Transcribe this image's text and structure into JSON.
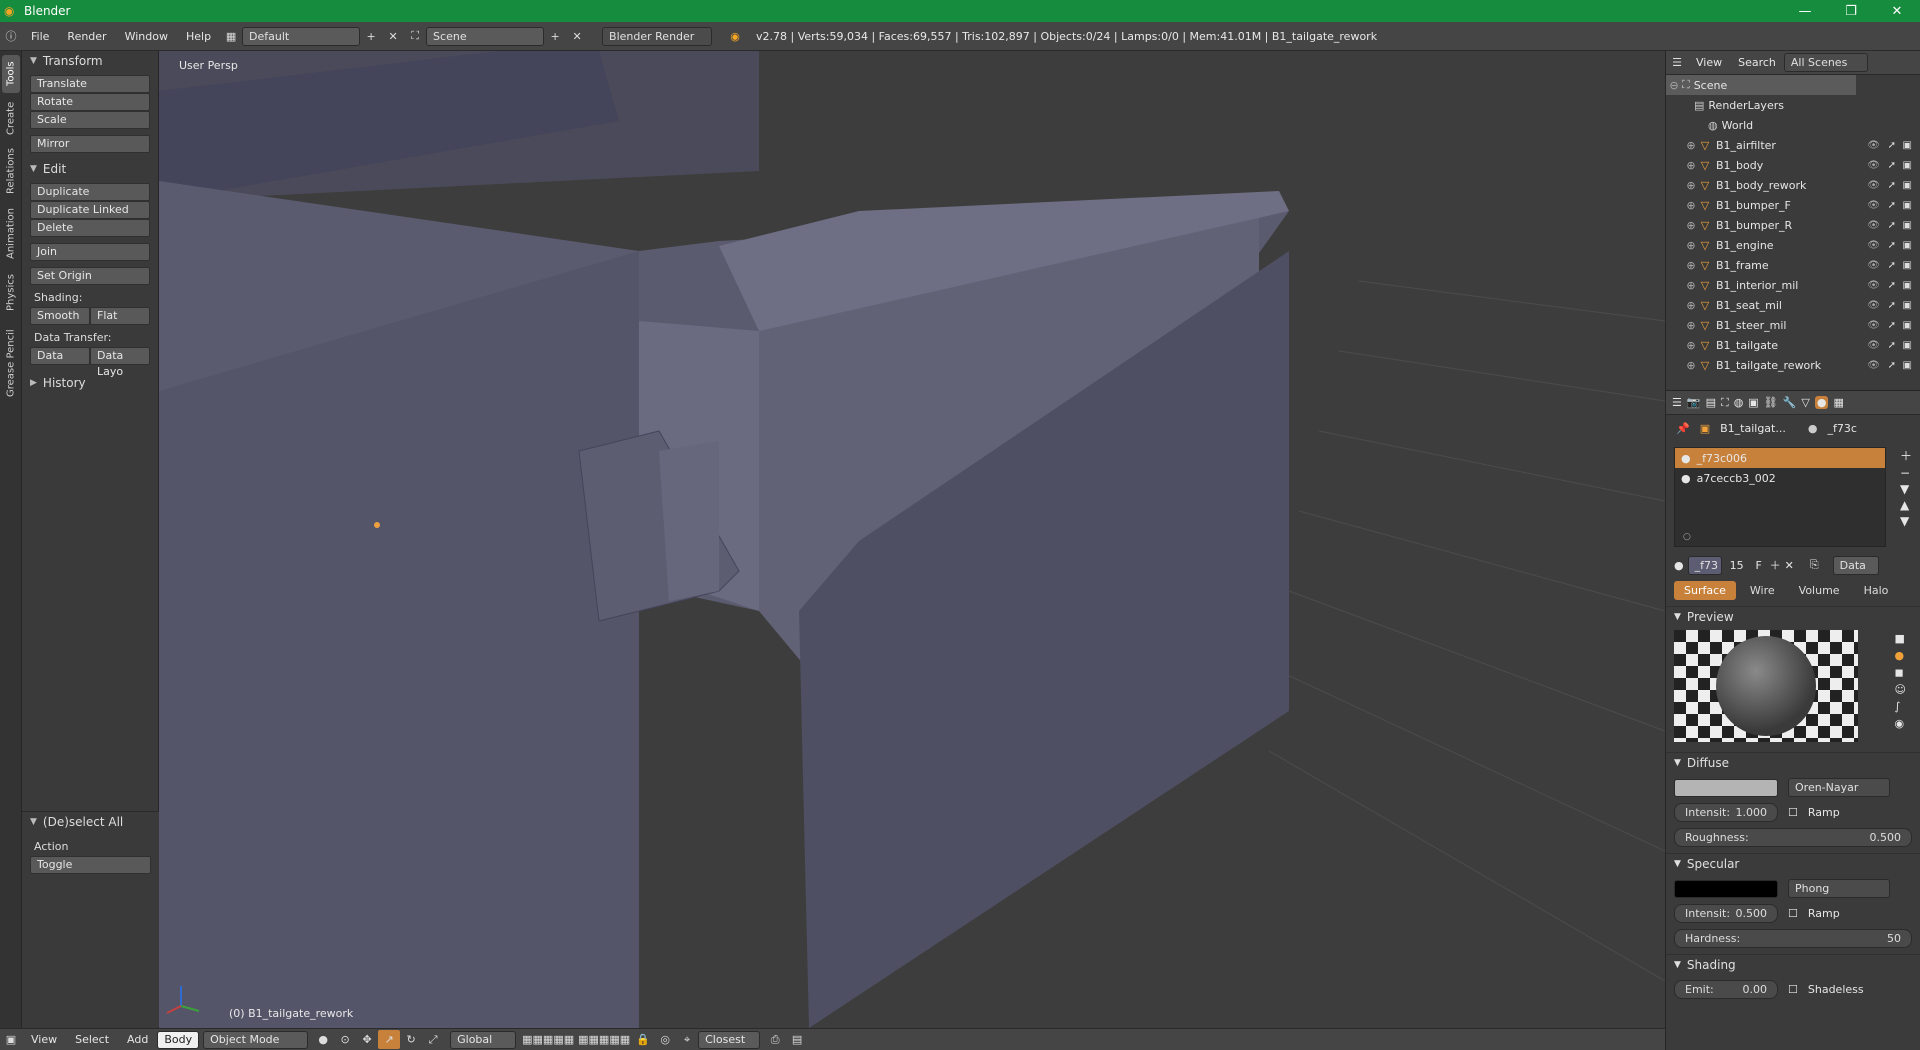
{
  "window": {
    "title": "Blender",
    "app_icon": "blender-logo-icon",
    "controls": [
      "minimize-icon",
      "maximize-icon",
      "close-icon"
    ]
  },
  "info_bar": {
    "menus": [
      "File",
      "Render",
      "Window",
      "Help"
    ],
    "layout": "Default",
    "scene": "Scene",
    "engine": "Blender Render",
    "stats": "v2.78 | Verts:59,034 | Faces:69,557 | Tris:102,897 | Objects:0/24 | Lamps:0/0 | Mem:41.01M | B1_tailgate_rework"
  },
  "left_tabs": [
    "Tools",
    "Create",
    "Relations",
    "Animation",
    "Physics",
    "Grease Pencil"
  ],
  "tool_shelf": {
    "transform": {
      "title": "Transform",
      "items": [
        "Translate",
        "Rotate",
        "Scale"
      ],
      "mirror": "Mirror"
    },
    "edit": {
      "title": "Edit",
      "items": [
        "Duplicate",
        "Duplicate Linked",
        "Delete"
      ],
      "join": "Join",
      "set_origin": "Set Origin",
      "shading_label": "Shading:",
      "smooth": "Smooth",
      "flat": "Flat",
      "data_transfer_label": "Data Transfer:",
      "data": "Data",
      "data_layo": "Data Layo"
    },
    "history": {
      "title": "History"
    },
    "operator": {
      "title": "(De)select All",
      "action_label": "Action",
      "action_value": "Toggle"
    }
  },
  "viewport": {
    "label": "User Persp",
    "object": "(0) B1_tailgate_rework"
  },
  "bottom_bar": {
    "menus": [
      "View",
      "Select",
      "Add"
    ],
    "body": "Body",
    "mode": "Object Mode",
    "orientation": "Global",
    "snap": "Closest"
  },
  "outliner": {
    "header": {
      "view": "View",
      "search": "Search",
      "scope": "All Scenes"
    },
    "scene": "Scene",
    "render_layers": "RenderLayers",
    "world": "World",
    "objects": [
      "B1_airfilter",
      "B1_body",
      "B1_body_rework",
      "B1_bumper_F",
      "B1_bumper_R",
      "B1_engine",
      "B1_frame",
      "B1_interior_mil",
      "B1_seat_mil",
      "B1_steer_mil",
      "B1_tailgate",
      "B1_tailgate_rework"
    ]
  },
  "properties": {
    "context": {
      "object": "B1_tailgat...",
      "material": "_f73c"
    },
    "materials": [
      "_f73c006",
      "a7ceccb3_002"
    ],
    "material_field": {
      "name": "_f73",
      "users": "15",
      "fake": "F",
      "link": "Data"
    },
    "tabs": [
      "Surface",
      "Wire",
      "Volume",
      "Halo"
    ],
    "active_tab": "Surface",
    "preview_title": "Preview",
    "diffuse": {
      "title": "Diffuse",
      "shader": "Oren-Nayar",
      "intensity_label": "Intensit:",
      "intensity": "1.000",
      "ramp": "Ramp",
      "roughness_label": "Roughness:",
      "roughness": "0.500",
      "color": "#b4b4b4"
    },
    "specular": {
      "title": "Specular",
      "shader": "Phong",
      "intensity_label": "Intensit:",
      "intensity": "0.500",
      "ramp": "Ramp",
      "hardness_label": "Hardness:",
      "hardness": "50",
      "color": "#000000"
    },
    "shading": {
      "title": "Shading",
      "emit_label": "Emit:",
      "emit": "0.00",
      "shadeless": "Shadeless"
    }
  },
  "colors": {
    "title_bar": "#168c3e",
    "accent": "#c7813a",
    "selected_row": "#6c6c6c"
  }
}
